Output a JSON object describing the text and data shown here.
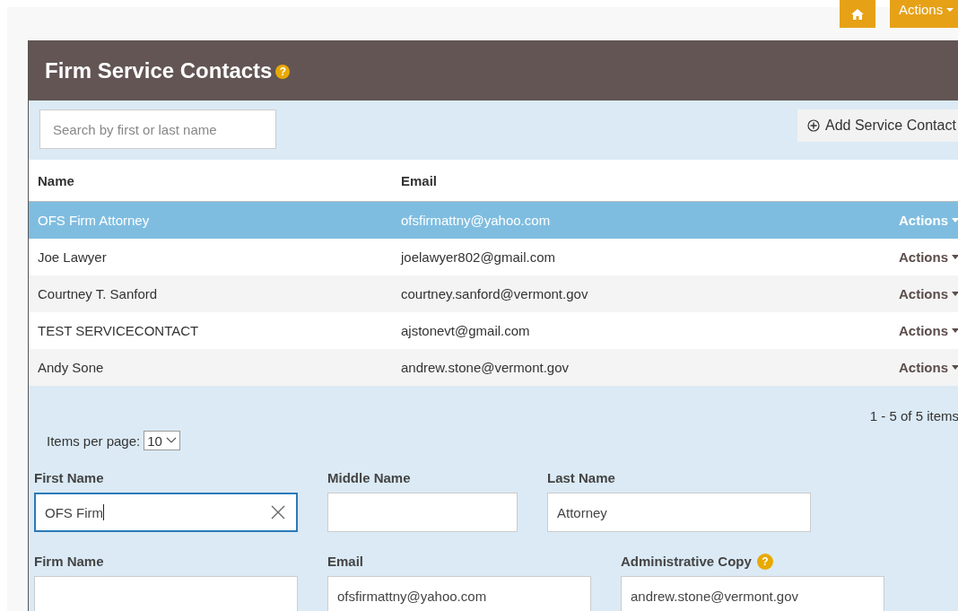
{
  "top_bar": {
    "actions_label": "Actions"
  },
  "panel": {
    "title": "Firm Service Contacts",
    "help": "?",
    "search": {
      "placeholder": "Search by first or last name"
    },
    "add_button": "Add Service Contact",
    "table": {
      "columns": [
        "Name",
        "Email"
      ],
      "rows": [
        {
          "name": "OFS Firm Attorney",
          "email": "ofsfirmattny@yahoo.com",
          "action": "Actions",
          "selected": true
        },
        {
          "name": "Joe Lawyer",
          "email": "joelawyer802@gmail.com",
          "action": "Actions",
          "selected": false
        },
        {
          "name": "Courtney T. Sanford",
          "email": "courtney.sanford@vermont.gov",
          "action": "Actions",
          "selected": false
        },
        {
          "name": "TEST SERVICECONTACT",
          "email": "ajstonevt@gmail.com",
          "action": "Actions",
          "selected": false
        },
        {
          "name": "Andy Sone",
          "email": "andrew.stone@vermont.gov",
          "action": "Actions",
          "selected": false
        }
      ]
    },
    "pagination": {
      "items_per_page_label": "Items per page:",
      "items_per_page": "10",
      "summary": "1 - 5 of 5 items"
    },
    "form": {
      "rows": [
        [
          {
            "label": "First Name",
            "value": "OFS Firm",
            "focused": true
          },
          {
            "label": "Middle Name",
            "focused": false
          },
          {
            "label": "Last Name",
            "value": "Attorney",
            "focused": false
          }
        ],
        [
          {
            "label": "Firm Name",
            "focused": false
          },
          {
            "label": "Email",
            "value": "ofsfirmattny@yahoo.com",
            "focused": false
          },
          {
            "label": "Administrative Copy",
            "value": "andrew.stone@vermont.gov",
            "focused": false,
            "help": "?"
          }
        ]
      ]
    }
  }
}
